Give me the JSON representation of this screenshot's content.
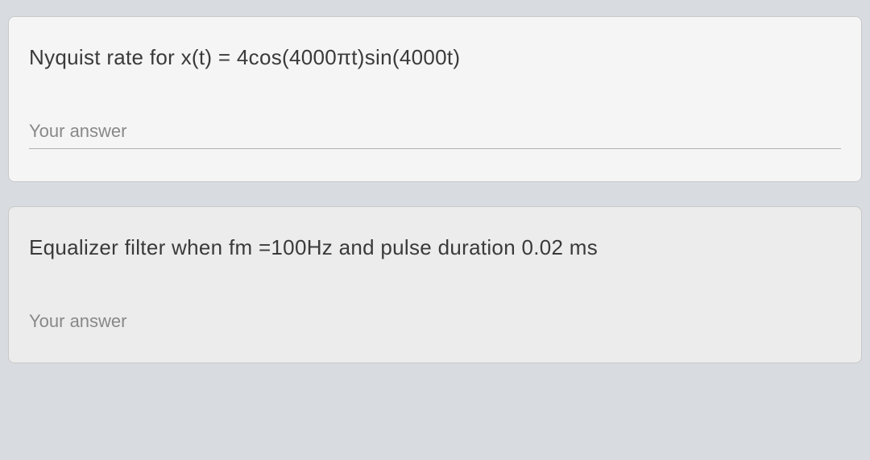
{
  "questions": [
    {
      "text": "Nyquist rate for x(t) = 4cos(4000πt)sin(4000t)",
      "answer_placeholder": "Your answer"
    },
    {
      "text": "Equalizer filter when fm =100Hz and pulse duration 0.02 ms",
      "answer_placeholder": "Your answer"
    }
  ]
}
